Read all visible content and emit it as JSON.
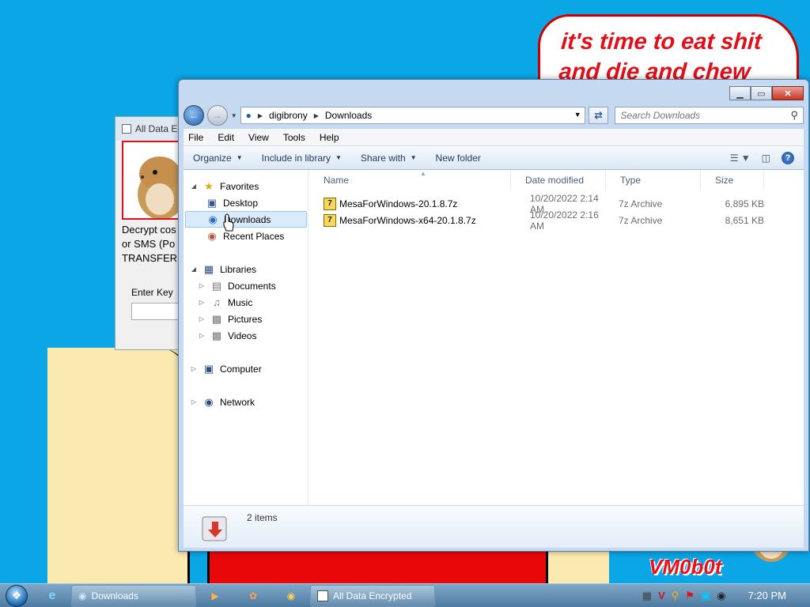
{
  "desktop": {
    "speech_line1": "it's time to eat shit",
    "speech_line2": "and die and chew",
    "watermark": "VM0b0t"
  },
  "background_dialog": {
    "title": "All Data E",
    "text_line1": "Decrypt cos",
    "text_line2": "or SMS (Po",
    "text_line3": "TRANSFER t",
    "key_label": "Enter Key"
  },
  "explorer": {
    "caption_buttons": {
      "minimize": "▁",
      "maximize": "▭",
      "close": "✕"
    },
    "address": {
      "crumbs": [
        "digibrony",
        "Downloads"
      ]
    },
    "search": {
      "placeholder": "Search Downloads"
    },
    "menu": [
      "File",
      "Edit",
      "View",
      "Tools",
      "Help"
    ],
    "commands": {
      "organize": "Organize",
      "include": "Include in library",
      "share": "Share with",
      "new_folder": "New folder"
    },
    "nav_tree": {
      "favorites": "Favorites",
      "desktop": "Desktop",
      "downloads": "Downloads",
      "recent": "Recent Places",
      "libraries": "Libraries",
      "documents": "Documents",
      "music": "Music",
      "pictures": "Pictures",
      "videos": "Videos",
      "computer": "Computer",
      "network": "Network"
    },
    "columns": {
      "name": "Name",
      "date": "Date modified",
      "type": "Type",
      "size": "Size"
    },
    "files": [
      {
        "name": "MesaForWindows-20.1.8.7z",
        "date": "10/20/2022 2:14 AM",
        "type": "7z Archive",
        "size": "6,895 KB"
      },
      {
        "name": "MesaForWindows-x64-20.1.8.7z",
        "date": "10/20/2022 2:16 AM",
        "type": "7z Archive",
        "size": "8,651 KB"
      }
    ],
    "details": {
      "count": "2 items"
    }
  },
  "taskbar": {
    "downloads_task": "Downloads",
    "encrypted_task": "All Data Encrypted",
    "clock": "7:20 PM"
  }
}
